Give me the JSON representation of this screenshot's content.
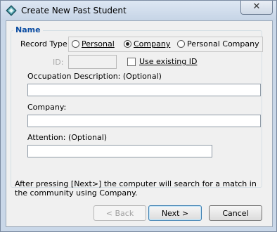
{
  "window": {
    "title": "Create New Past Student",
    "close_glyph": "✕"
  },
  "group": {
    "legend": "Name"
  },
  "record_type": {
    "label": "Record Type:",
    "options": [
      {
        "label": "Personal",
        "selected": false
      },
      {
        "label": "Company",
        "selected": true
      },
      {
        "label": "Personal Company",
        "selected": false
      }
    ]
  },
  "id_field": {
    "label": "ID:",
    "value": "",
    "use_existing_label": "Use existing ID",
    "use_existing_checked": false
  },
  "occupation": {
    "label": "Occupation Description: (Optional)",
    "value": ""
  },
  "company": {
    "label": "Company:",
    "value": ""
  },
  "attention": {
    "label": "Attention:  (Optional)",
    "value": ""
  },
  "note": "After pressing [Next>] the computer will search for a match in the community using Company.",
  "buttons": {
    "back": "< Back",
    "next": "Next >",
    "cancel": "Cancel"
  },
  "icons": {
    "app": "app-diamond-icon",
    "close": "close-icon"
  }
}
